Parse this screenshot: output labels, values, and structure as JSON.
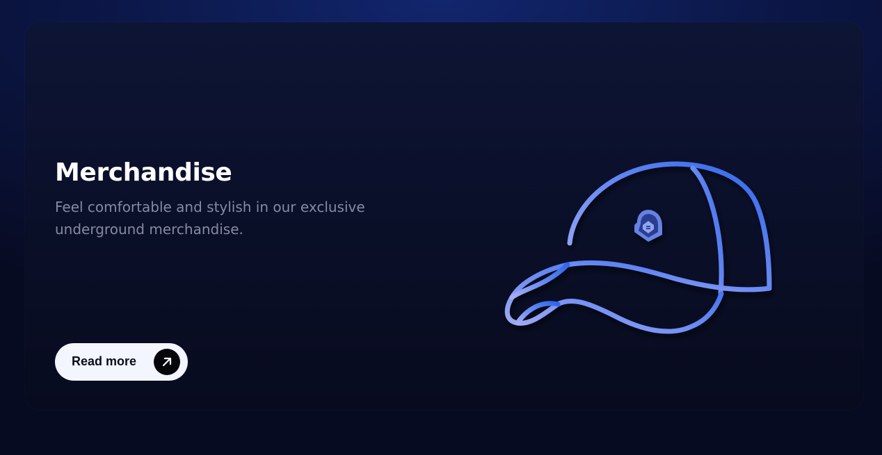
{
  "card": {
    "title": "Merchandise",
    "description": "Feel comfortable and stylish in our exclusive underground merchandise.",
    "cta_label": "Read more",
    "cta_icon": "arrow-up-right-icon",
    "illustration": "baseball-cap-icon"
  },
  "colors": {
    "background": "#0b1645",
    "card": "#0a0f28",
    "title": "#ffffff",
    "description": "#868aa1",
    "button": "#f3f5ff",
    "accent_start": "#9ea7f0",
    "accent_end": "#3f6ff0"
  }
}
